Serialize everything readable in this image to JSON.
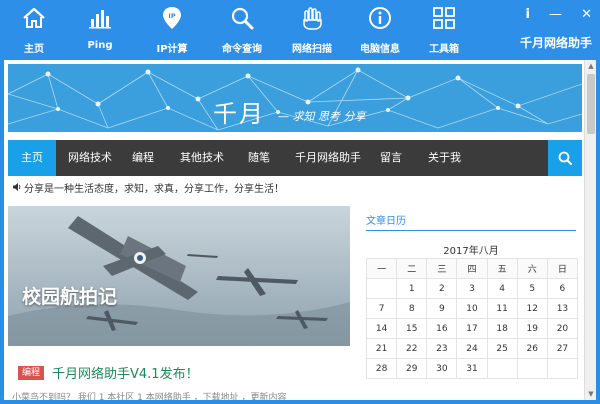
{
  "toolbar": {
    "items": [
      {
        "label": "主页",
        "icon": "home-icon"
      },
      {
        "label": "Ping",
        "icon": "bar-chart-icon"
      },
      {
        "label": "IP计算",
        "icon": "ip-pin-icon"
      },
      {
        "label": "命令查询",
        "icon": "magnifier-icon"
      },
      {
        "label": "网络扫描",
        "icon": "hand-icon"
      },
      {
        "label": "电脑信息",
        "icon": "info-icon"
      },
      {
        "label": "工具箱",
        "icon": "grid-icon"
      }
    ],
    "app_title": "千月网络助手",
    "info_btn": "i",
    "minimize_btn": "—",
    "close_btn": "✕"
  },
  "colors": {
    "accent": "#2d8fe8",
    "nav_bg": "#3b3b3b",
    "nav_active": "#18a1e8",
    "tag_red": "#d9534f",
    "title_green": "#1a8a5a"
  },
  "banner": {
    "title": "千月",
    "subtitle": "— 求知 思考 分享"
  },
  "nav": {
    "home": "主页",
    "items": [
      "网络技术",
      "编程",
      "其他技术",
      "随笔",
      "千月网络助手",
      "留言",
      "关于我"
    ],
    "search_icon": "search-icon"
  },
  "notice": {
    "text": "分享是一种生活态度，求知，求真，分享工作，分享生活！"
  },
  "feature": {
    "caption": "校园航拍记"
  },
  "post": {
    "tag": "编程",
    "title": "千月网络助手V4.1发布！",
    "excerpt": "小菜鸟不到吗？ 我们 1 本社区 1 本网络助手 ，下载地址 ，更新内容"
  },
  "calendar": {
    "title": "文章日历",
    "caption": "2017年八月",
    "weekdays": [
      "一",
      "二",
      "三",
      "四",
      "五",
      "六",
      "日"
    ],
    "rows": [
      [
        "",
        "1",
        "2",
        "3",
        "4",
        "5",
        "6"
      ],
      [
        "7",
        "8",
        "9",
        "10",
        "11",
        "12",
        "13"
      ],
      [
        "14",
        "15",
        "16",
        "17",
        "18",
        "19",
        "20"
      ],
      [
        "21",
        "22",
        "23",
        "24",
        "25",
        "26",
        "27"
      ],
      [
        "28",
        "29",
        "30",
        "31",
        "",
        "",
        ""
      ]
    ]
  }
}
